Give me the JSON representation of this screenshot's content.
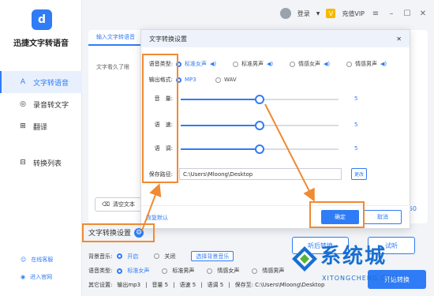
{
  "app": {
    "name": "迅捷文字转语音",
    "logo_glyph": "d"
  },
  "topbar": {
    "login": "登录",
    "vip": "充值VIP"
  },
  "sidebar": {
    "items": [
      {
        "label": "文字转语音",
        "icon": "text-icon",
        "active": true
      },
      {
        "label": "录音转文字",
        "icon": "mic-icon",
        "active": false
      },
      {
        "label": "翻译",
        "icon": "translate-icon",
        "active": false
      },
      {
        "label": "转换列表",
        "icon": "list-icon",
        "active": false
      }
    ],
    "footer": {
      "service": "在线客服",
      "website": "进入官网"
    }
  },
  "main": {
    "tab": "输入文字转语音",
    "text_preview": "文字看久了眼",
    "clear_label": "清空文本",
    "count": "50"
  },
  "settings": {
    "title": "文字转换设置",
    "bg_music_label": "背景音乐:",
    "bg_on": "开启",
    "bg_off": "关闭",
    "bg_button": "选择背景音乐",
    "voice_label": "语音类型:",
    "voices": [
      "标准女声",
      "标准男声",
      "情感女声",
      "情感男声"
    ],
    "other_label": "其它设置:",
    "other": [
      "输出mp3",
      "音量 5",
      "语速 5",
      "语调 5",
      "保存至: C:\\Users\\Mloong\\Desktop"
    ],
    "trial_label": "试听",
    "convert_label": "开始转换",
    "preview_label": "听后转换"
  },
  "dialog": {
    "title": "文字转换设置",
    "voice_label": "语音类型:",
    "voices": [
      "标准女声",
      "标准男声",
      "情感女声",
      "情感男声"
    ],
    "format_label": "输出格式:",
    "formats": [
      "MP3",
      "WAV"
    ],
    "sliders": [
      {
        "label": "音　量:",
        "value": 5,
        "fraction": 0.5
      },
      {
        "label": "语　速:",
        "value": 5,
        "fraction": 0.5
      },
      {
        "label": "语　调:",
        "value": 5,
        "fraction": 0.5
      }
    ],
    "path_label": "保存路径:",
    "path": "C:\\Users\\Mloong\\Desktop",
    "change": "更改",
    "reset": "恢复默认",
    "ok": "确定",
    "cancel": "取消"
  },
  "watermark": {
    "text": "系统城",
    "sub": "XITONGCHENG.COM"
  },
  "colors": {
    "accent": "#2f7cf6",
    "annotation": "#f08a33"
  }
}
